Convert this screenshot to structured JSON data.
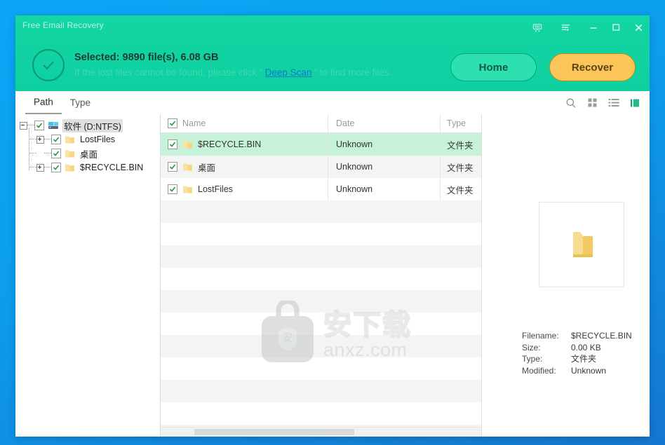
{
  "window": {
    "title": "Free Email Recovery",
    "titlebar_icons": [
      {
        "name": "cart-icon",
        "label": "Cart"
      },
      {
        "name": "menu-list-icon",
        "label": "Menu"
      },
      {
        "name": "minimize-icon",
        "label": "Minimize"
      },
      {
        "name": "maximize-icon",
        "label": "Maximize"
      },
      {
        "name": "close-icon",
        "label": "Close"
      }
    ]
  },
  "header": {
    "status_icon": "check-circle-icon",
    "summary": "Selected: 9890 file(s), 6.08 GB",
    "hint_before": "If the lost files cannot be found, please click ”",
    "hint_link": "Deep Scan",
    "hint_after": "” to find more files.",
    "home_label": "Home",
    "recover_label": "Recover",
    "accent_green": "#12d3a2",
    "recover_color": "#fbc559",
    "link_color": "#1278d4"
  },
  "tabs": [
    {
      "label": "Path",
      "active": true
    },
    {
      "label": "Type",
      "active": false
    }
  ],
  "view_icons": [
    {
      "name": "search-icon",
      "active": false
    },
    {
      "name": "grid-view-icon",
      "active": false
    },
    {
      "name": "list-view-icon",
      "active": false
    },
    {
      "name": "detail-view-icon",
      "active": true
    }
  ],
  "tree": [
    {
      "label": "软件 (D:NTFS)",
      "icon": "drive-icon",
      "expander": "minus",
      "checked": true,
      "depth": 0,
      "selected": true
    },
    {
      "label": "LostFiles",
      "icon": "folder-icon",
      "expander": "plus",
      "checked": true,
      "depth": 1,
      "selected": false
    },
    {
      "label": "桌面",
      "icon": "folder-icon",
      "expander": "none",
      "checked": true,
      "depth": 1,
      "selected": false
    },
    {
      "label": "$RECYCLE.BIN",
      "icon": "folder-icon",
      "expander": "plus",
      "checked": true,
      "depth": 1,
      "selected": false
    }
  ],
  "file_list": {
    "columns": [
      "Name",
      "Date",
      "Type"
    ],
    "header_checked": true,
    "rows": [
      {
        "name": "$RECYCLE.BIN",
        "date": "Unknown",
        "type": "文件夹",
        "checked": true,
        "selected": true
      },
      {
        "name": "桌面",
        "date": "Unknown",
        "type": "文件夹",
        "checked": true,
        "selected": false
      },
      {
        "name": "LostFiles",
        "date": "Unknown",
        "type": "文件夹",
        "checked": true,
        "selected": false
      }
    ],
    "empty_row_count": 11
  },
  "preview": {
    "thumbnail_icon": "folder-icon",
    "fields": [
      {
        "key": "Filename:",
        "value": "$RECYCLE.BIN"
      },
      {
        "key": "Size:",
        "value": "0.00 KB"
      },
      {
        "key": "Type:",
        "value": "文件夹"
      },
      {
        "key": "Modified:",
        "value": "Unknown"
      }
    ]
  },
  "watermark": {
    "cn": "安下载",
    "en": "anxz.com",
    "logo_icon": "bag-logo-icon"
  }
}
